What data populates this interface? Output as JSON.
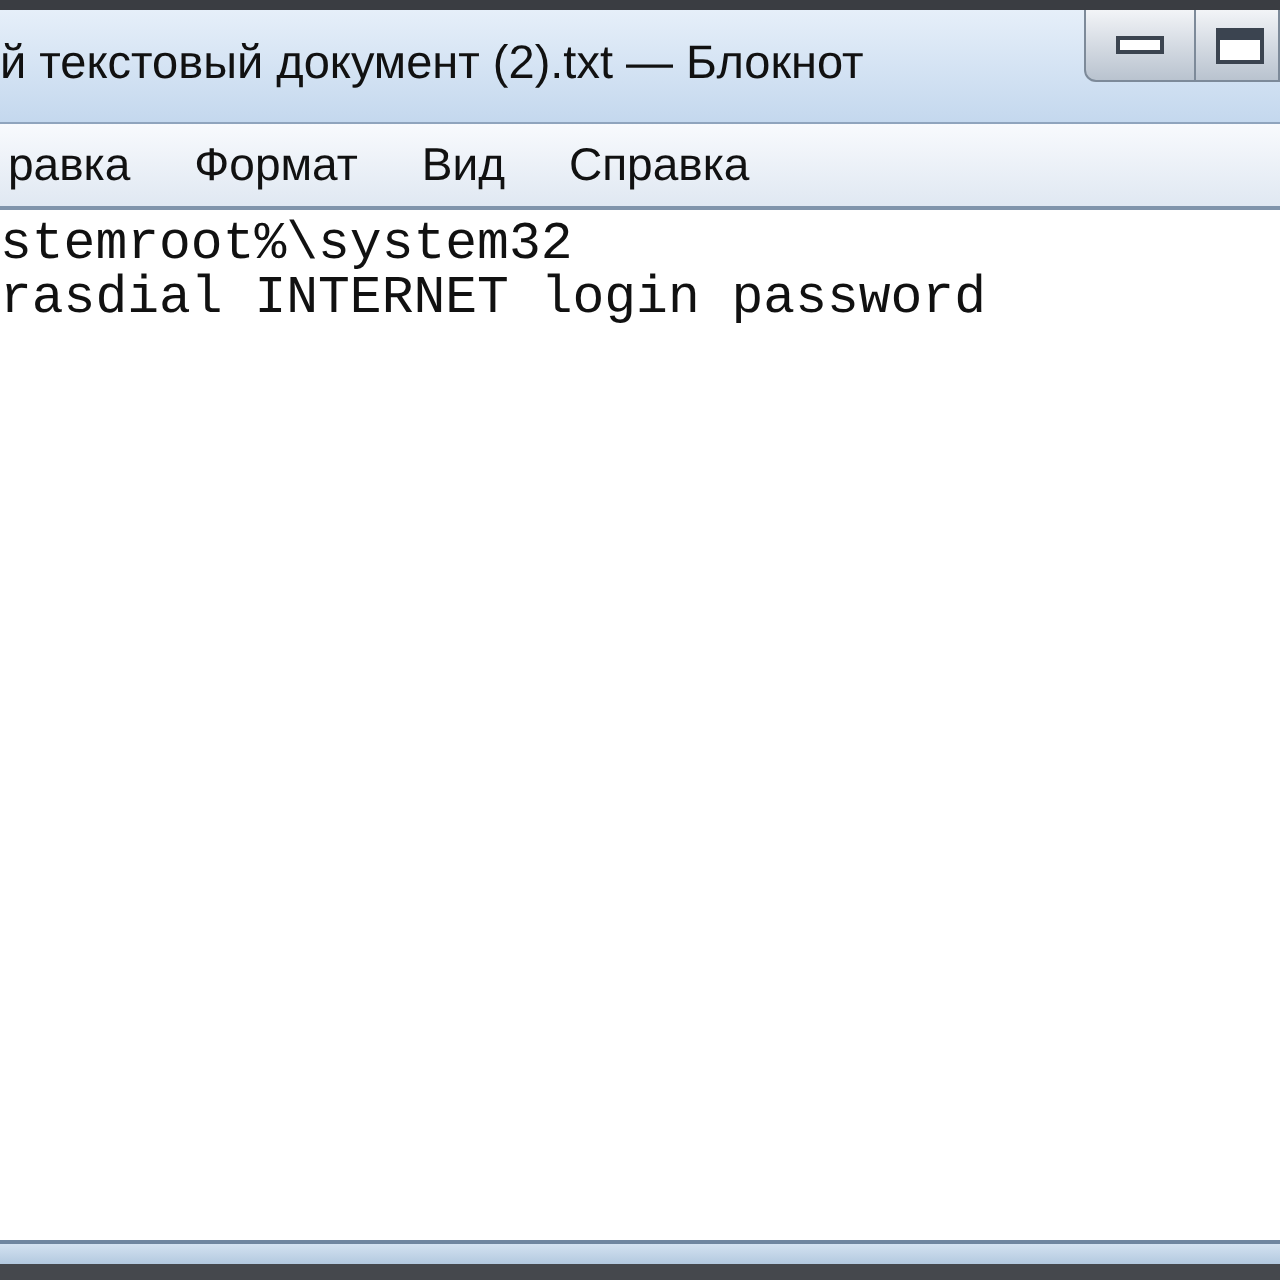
{
  "window": {
    "title": "й текстовый документ (2).txt — Блокнот"
  },
  "menu": [
    "равка",
    "Формат",
    "Вид",
    "Справка"
  ],
  "editor": {
    "lines": [
      "stemroot%\\system32",
      "rasdial INTERNET login password"
    ]
  }
}
